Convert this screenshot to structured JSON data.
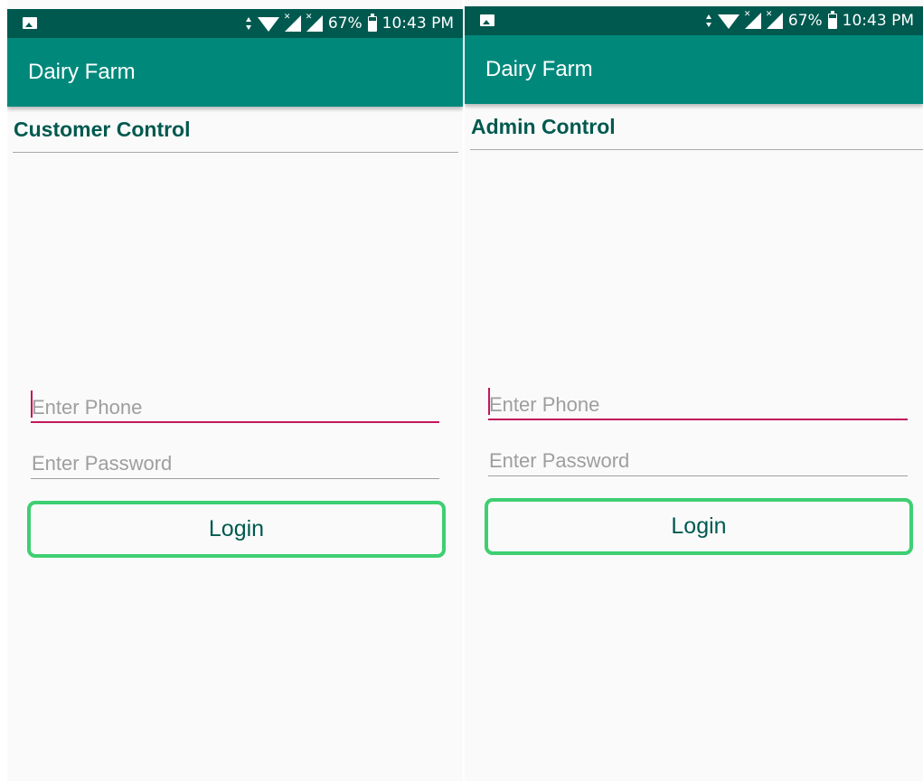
{
  "status_bar": {
    "battery": "67%",
    "time": "10:43 PM",
    "icons": [
      "gallery-icon",
      "data-arrows-icon",
      "wifi-icon",
      "signal-x-icon",
      "signal-x-icon",
      "battery-icon"
    ]
  },
  "screens": [
    {
      "app_title": "Dairy Farm",
      "section_title": "Customer Control",
      "phone_placeholder": "Enter Phone",
      "password_placeholder": "Enter Password",
      "login_label": "Login"
    },
    {
      "app_title": "Dairy Farm",
      "section_title": "Admin Control",
      "phone_placeholder": "Enter Phone",
      "password_placeholder": "Enter Password",
      "login_label": "Login"
    }
  ],
  "colors": {
    "status_bar": "#00594f",
    "app_bar": "#00897b",
    "focus_accent": "#c2185b",
    "button_border": "#3ecf72"
  }
}
